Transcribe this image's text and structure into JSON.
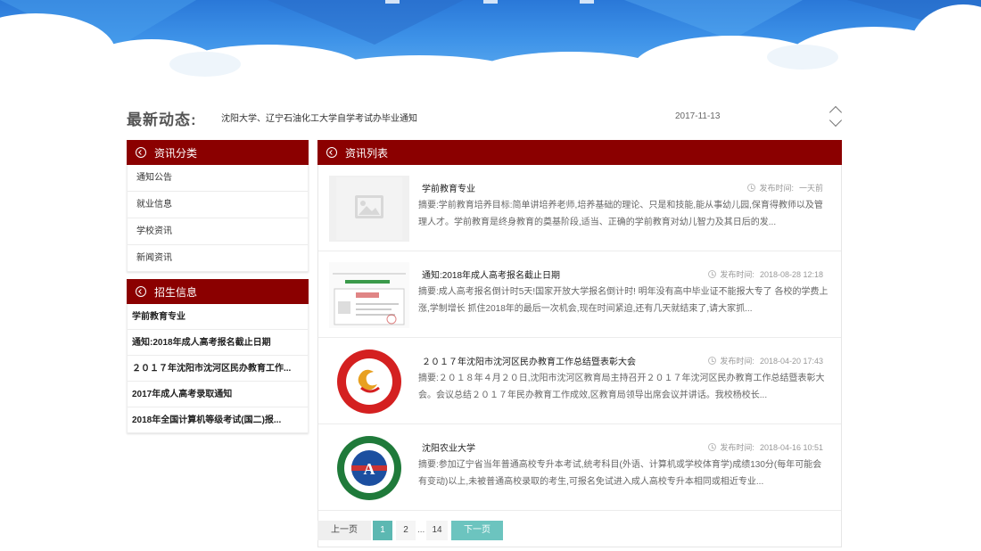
{
  "colors": {
    "brand_red": "#8b0000",
    "pager_active": "#5cb8b2",
    "pager_next": "#6cc4bf"
  },
  "latest": {
    "title": "最新动态:",
    "text": "沈阳大学、辽宁石油化工大学自学考试办毕业通知",
    "date": "2017-11-13"
  },
  "categories": {
    "header": "资讯分类",
    "icon": "chevron-circle-left-icon",
    "items": [
      "通知公告",
      "就业信息",
      "学校资讯",
      "新闻资讯"
    ]
  },
  "enrollment": {
    "header": "招生信息",
    "icon": "chevron-circle-left-icon",
    "items": [
      "学前教育专业",
      "通知:2018年成人高考报名截止日期",
      "２０１７年沈阳市沈河区民办教育工作...",
      "2017年成人高考录取通知",
      "2018年全国计算机等级考试(国二)报..."
    ]
  },
  "news_list": {
    "header": "资讯列表",
    "icon": "chevron-circle-left-icon",
    "time_label": "发布时间:",
    "items": [
      {
        "title": "学前教育专业",
        "time": "一天前",
        "summary": "摘要:学前教育培养目标:简单讲培养老师,培养基础的理论、只是和技能,能从事幼儿园,保育得教师以及管理人才。学前教育是终身教育的奠基阶段,适当、正确的学前教育对幼儿智力及其日后的发...",
        "thumb": "placeholder-image-icon"
      },
      {
        "title": "通知:2018年成人高考报名截止日期",
        "time": "2018-08-28 12:18",
        "summary": "摘要:成人高考报名倒计时5天!国家开放大学报名倒计时! 明年没有高中毕业证不能报大专了 各校的学费上涨,学制增长 抓住2018年的最后一次机会,现在时间紧迫,还有几天就结束了,请大家抓...",
        "thumb": "document-thumbnail"
      },
      {
        "title": "２０１７年沈阳市沈河区民办教育工作总结暨表彰大会",
        "time": "2018-04-20 17:43",
        "summary": "摘要:２０１８年４月２０日,沈阳市沈河区教育局主持召开２０１７年沈河区民办教育工作总结暨表彰大会。会议总结２０１７年民办教育工作成效,区教育局领导出席会议并讲话。我校杨校长...",
        "thumb": "red-school-emblem"
      },
      {
        "title": "沈阳农业大学",
        "time": "2018-04-16 10:51",
        "summary": "摘要:参加辽宁省当年普通高校专升本考试,统考科目(外语、计算机或学校体育学)成绩130分(每年可能会有变动)以上,未被普通高校录取的考生,可报名免试进入成人高校专升本相同或相近专业...",
        "thumb": "green-university-emblem"
      }
    ]
  },
  "pagination": {
    "prev": "上一页",
    "pages": [
      "1",
      "2"
    ],
    "dots": "...",
    "last": "14",
    "next": "下一页",
    "current": "1"
  }
}
